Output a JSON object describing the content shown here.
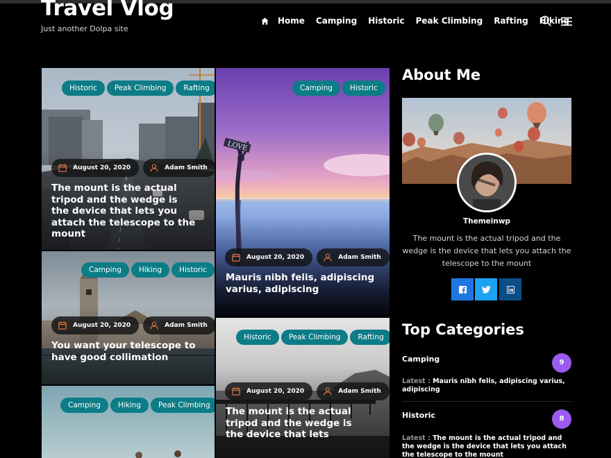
{
  "site": {
    "title": "Travel Vlog",
    "tagline": "Just another Dolpa site"
  },
  "nav": {
    "home_icon": "home-icon",
    "items": [
      "Home",
      "Camping",
      "Historic",
      "Peak Climbing",
      "Rafting",
      "Hiking"
    ],
    "search_icon": "search-icon",
    "menu_icon": "hamburger-menu-icon"
  },
  "posts": [
    {
      "tags": [
        "Historic",
        "Peak Climbing",
        "Rafting"
      ],
      "date": "August 20, 2020",
      "author": "Adam Smith",
      "title": "The mount is the actual tripod and the wedge is the device that lets you attach the telescope to the mount"
    },
    {
      "tags": [
        "Camping",
        "Historic"
      ],
      "date": "August 20, 2020",
      "author": "Adam Smith",
      "title": "Mauris nibh felis, adipiscing varius, adipiscing"
    },
    {
      "tags": [
        "Camping",
        "Hiking",
        "Historic"
      ],
      "date": "August 20, 2020",
      "author": "Adam Smith",
      "title": "You want your telescope to have good collimation"
    },
    {
      "tags": [
        "Historic",
        "Peak Climbing",
        "Rafting"
      ],
      "date": "August 20, 2020",
      "author": "Adam Smith",
      "title": "The mount is the actual tripod and the wedge is the device that lets"
    },
    {
      "tags": [
        "Camping",
        "Hiking",
        "Peak Climbing"
      ]
    }
  ],
  "sidebar": {
    "about_title": "About Me",
    "name": "Themeinwp",
    "bio": "The mount is the actual tripod and the wedge is the device that lets you attach the telescope to the mount",
    "social": [
      {
        "icon": "facebook-icon",
        "color": "#1e77e0"
      },
      {
        "icon": "twitter-icon",
        "color": "#1da1f2"
      },
      {
        "icon": "linkedin-icon",
        "color": "#0b4d86"
      }
    ],
    "categories_title": "Top Categories",
    "latest_label": "Latest :",
    "categories": [
      {
        "name": "Camping",
        "count": "9",
        "latest": "Mauris nibh felis, adipiscing varius, adipiscing"
      },
      {
        "name": "Historic",
        "count": "8",
        "latest": "The mount is the actual tripod and the wedge is the device that lets you attach the telescope to the mount"
      }
    ]
  },
  "colors": {
    "tag": "#0c7c86",
    "count_badge": "#9b5bf0",
    "background": "#000000"
  }
}
